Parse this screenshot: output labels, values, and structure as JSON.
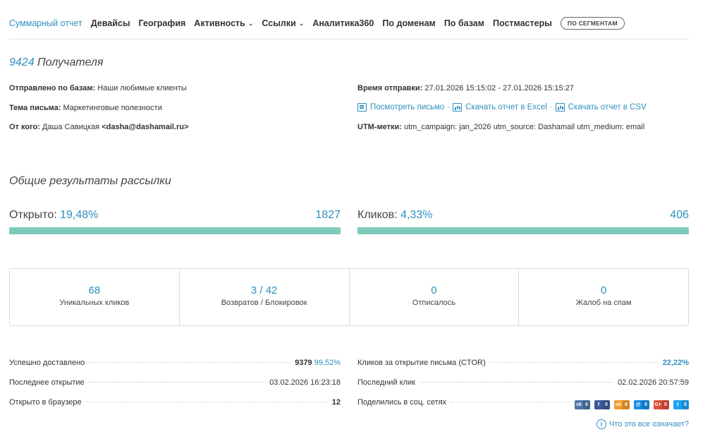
{
  "nav": {
    "items": [
      {
        "label": "Суммарный отчет",
        "active": true
      },
      {
        "label": "Девайсы"
      },
      {
        "label": "География"
      },
      {
        "label": "Активность",
        "dropdown": true
      },
      {
        "label": "Ссылки",
        "dropdown": true
      },
      {
        "label": "Аналитика360"
      },
      {
        "label": "По доменам"
      },
      {
        "label": "По базам"
      },
      {
        "label": "Постмастеры"
      }
    ],
    "segment_button": "ПО СЕГМЕНТАМ"
  },
  "recipients": {
    "count": "9424",
    "label": "Получателя"
  },
  "info_left": [
    {
      "key": "Отправлено по базам:",
      "value": "Наши любимые клиенты"
    },
    {
      "key": "Тема письма:",
      "value": "Маркетинговые полезности"
    },
    {
      "key": "От кого:",
      "value": "Даша Савицкая",
      "email": "<dasha@dashamail.ru>"
    }
  ],
  "info_right": {
    "send_time_key": "Время отправки:",
    "send_time_value": "27.01.2026 15:15:02 - 27.01.2026 15:15:27",
    "view_letter": "Посмотреть письмо",
    "download_excel": "Скачать отчет в Excel",
    "download_csv": "Скачать отчет в CSV",
    "separator": "·",
    "utm_key": "UTM-метки:",
    "utm_value": "utm_campaign: jan_2026 utm_source: Dashamail utm_medium: email"
  },
  "section_title": "Общие результаты рассылки",
  "opened": {
    "label": "Открыто:",
    "percent": "19,48%",
    "count": "1827",
    "fill": 1.0
  },
  "clicks": {
    "label": "Кликов:",
    "percent": "4,33%",
    "count": "406",
    "fill": 1.0
  },
  "stats": [
    {
      "value": "68",
      "label": "Уникальных кликов"
    },
    {
      "value": "3 / 42",
      "label": "Возвратов / Блокировок"
    },
    {
      "value": "0",
      "label": "Отписалось"
    },
    {
      "value": "0",
      "label": "Жалоб на спам"
    }
  ],
  "details_left": [
    {
      "label": "Успешно доставлено",
      "value": "9379",
      "extra": "99,52%"
    },
    {
      "label": "Последнее открытие",
      "value": "03.02.2026 16:23:18"
    },
    {
      "label": "Открыто в браузере",
      "value": "12"
    }
  ],
  "details_right": [
    {
      "label": "Кликов за открытие письма (CTOR)",
      "value": "22,22%"
    },
    {
      "label": "Последний клик",
      "value": "02.02.2026 20:57:59"
    },
    {
      "label": "Поделились в соц. сетях"
    }
  ],
  "social": [
    {
      "icon": "vk-icon",
      "glyph": "vk",
      "count": "0",
      "color": "#4a76a8"
    },
    {
      "icon": "facebook-icon",
      "glyph": "f",
      "count": "0",
      "color": "#3b5998"
    },
    {
      "icon": "odnoklassniki-icon",
      "glyph": "ok",
      "count": "0",
      "color": "#f59a2b"
    },
    {
      "icon": "mailru-icon",
      "glyph": "@",
      "count": "0",
      "color": "#168de2"
    },
    {
      "icon": "googleplus-icon",
      "glyph": "G+",
      "count": "0",
      "color": "#dd4b39"
    },
    {
      "icon": "twitter-icon",
      "glyph": "t",
      "count": "0",
      "color": "#1da1f2"
    }
  ],
  "help": {
    "glyph": "i",
    "label": "Что это все означает?"
  },
  "colors": {
    "accent": "#2f8fbf",
    "bar": "#7fcabb"
  }
}
